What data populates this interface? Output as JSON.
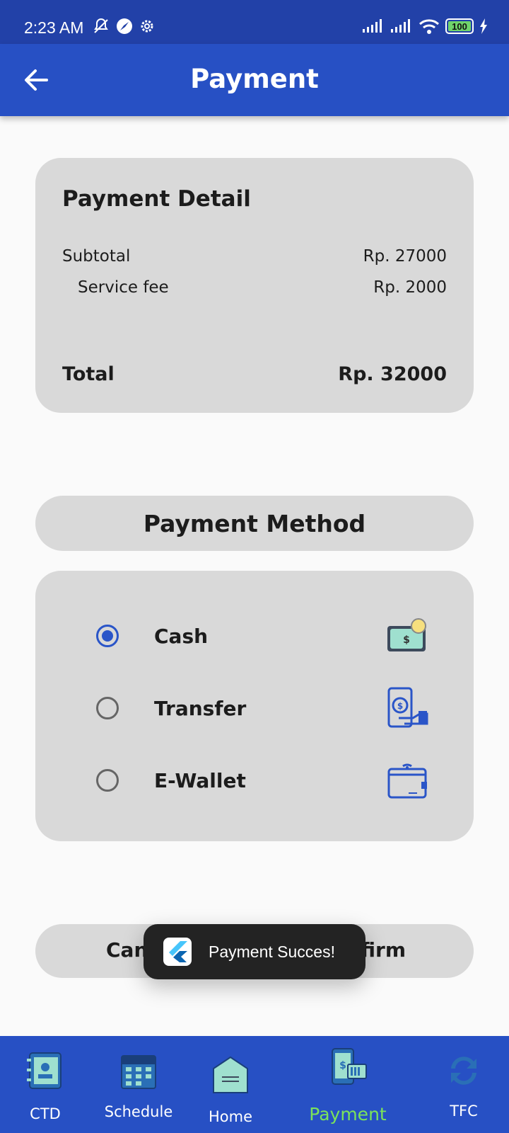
{
  "status_bar": {
    "time": "2:23 AM",
    "battery": "100"
  },
  "app_bar": {
    "title": "Payment"
  },
  "payment_detail": {
    "title": "Payment Detail",
    "subtotal_label": "Subtotal",
    "subtotal_value": "Rp. 27000",
    "fee_label": "Service fee",
    "fee_value": "Rp. 2000",
    "total_label": "Total",
    "total_value": "Rp. 32000"
  },
  "payment_method": {
    "title": "Payment Method",
    "options": [
      {
        "label": "Cash",
        "selected": true,
        "icon": "cash-icon"
      },
      {
        "label": "Transfer",
        "selected": false,
        "icon": "transfer-icon"
      },
      {
        "label": "E-Wallet",
        "selected": false,
        "icon": "wallet-icon"
      }
    ]
  },
  "actions": {
    "cancel_label": "Can",
    "confirm_label": "nfirm"
  },
  "toast": {
    "message": "Payment Succes!"
  },
  "bottom_nav": {
    "items": [
      {
        "label": "CTD",
        "icon": "contacts-icon"
      },
      {
        "label": "Schedule",
        "icon": "calendar-icon"
      },
      {
        "label": "Home",
        "icon": "home-icon"
      },
      {
        "label": "Payment",
        "icon": "payment-icon",
        "active": true
      },
      {
        "label": "TFC",
        "icon": "sync-icon"
      }
    ]
  },
  "colors": {
    "primary": "#2750c4",
    "card": "#d9d9d9",
    "active_nav": "#7be35a",
    "radio": "#2a55c8"
  }
}
